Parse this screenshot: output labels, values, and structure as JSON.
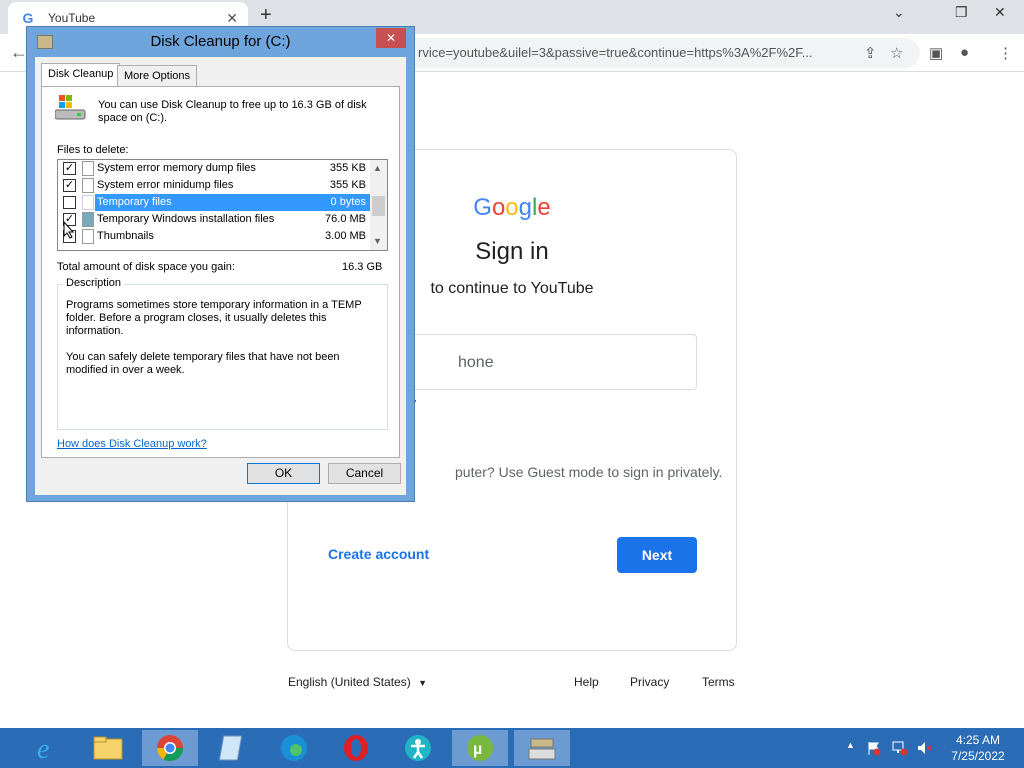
{
  "browser": {
    "tab_title": "YouTube",
    "tab_close": "✕",
    "new_tab": "+",
    "url": "rvice=youtube&uilel=3&passive=true&continue=https%3A%2F%2F...",
    "back": "←",
    "win_minimize": "⌄",
    "win_restore": "❐",
    "win_close": "✕"
  },
  "google": {
    "logo_letters": [
      "G",
      "o",
      "o",
      "g",
      "l",
      "e"
    ],
    "logo_colors": [
      "#4285f4",
      "#ea4335",
      "#fbbc05",
      "#4285f4",
      "#34a853",
      "#ea4335"
    ],
    "title": "Sign in",
    "subtitle": "to continue to YouTube",
    "email_placeholder_visible": "hone",
    "forgot_visible": "",
    "guest_text": "puter? Use Guest mode to sign in privately.",
    "create_account": "Create account",
    "next": "Next",
    "language": "English (United States)",
    "footer": {
      "help": "Help",
      "privacy": "Privacy",
      "terms": "Terms"
    }
  },
  "dialog": {
    "title": "Disk Cleanup for  (C:)",
    "close": "✕",
    "tabs": [
      "Disk Cleanup",
      "More Options"
    ],
    "intro": "You can use Disk Cleanup to free up to 16.3 GB of disk space on  (C:).",
    "files_label": "Files to delete:",
    "files": [
      {
        "name": "System error memory dump files",
        "size": "355 KB",
        "checked": true,
        "selected": false
      },
      {
        "name": "System error minidump files",
        "size": "355 KB",
        "checked": true,
        "selected": false
      },
      {
        "name": "Temporary files",
        "size": "0 bytes",
        "checked": false,
        "selected": true
      },
      {
        "name": "Temporary Windows installation files",
        "size": "76.0 MB",
        "checked": true,
        "selected": false
      },
      {
        "name": "Thumbnails",
        "size": "3.00 MB",
        "checked": false,
        "selected": false
      }
    ],
    "total_label": "Total amount of disk space you gain:",
    "total_value": "16.3 GB",
    "description_label": "Description",
    "description_p1": "Programs sometimes store temporary information in a TEMP folder. Before a program closes, it usually deletes this information.",
    "description_p2": "You can safely delete temporary files that have not been modified in over a week.",
    "help_link": "How does Disk Cleanup work?",
    "ok": "OK",
    "cancel": "Cancel"
  },
  "taskbar": {
    "time": "4:25 AM",
    "date": "7/25/2022",
    "apps": [
      "internet-explorer",
      "file-explorer",
      "chrome",
      "notepad",
      "edge",
      "opera",
      "accessibility",
      "utorrent",
      "disk-cleanup"
    ]
  }
}
